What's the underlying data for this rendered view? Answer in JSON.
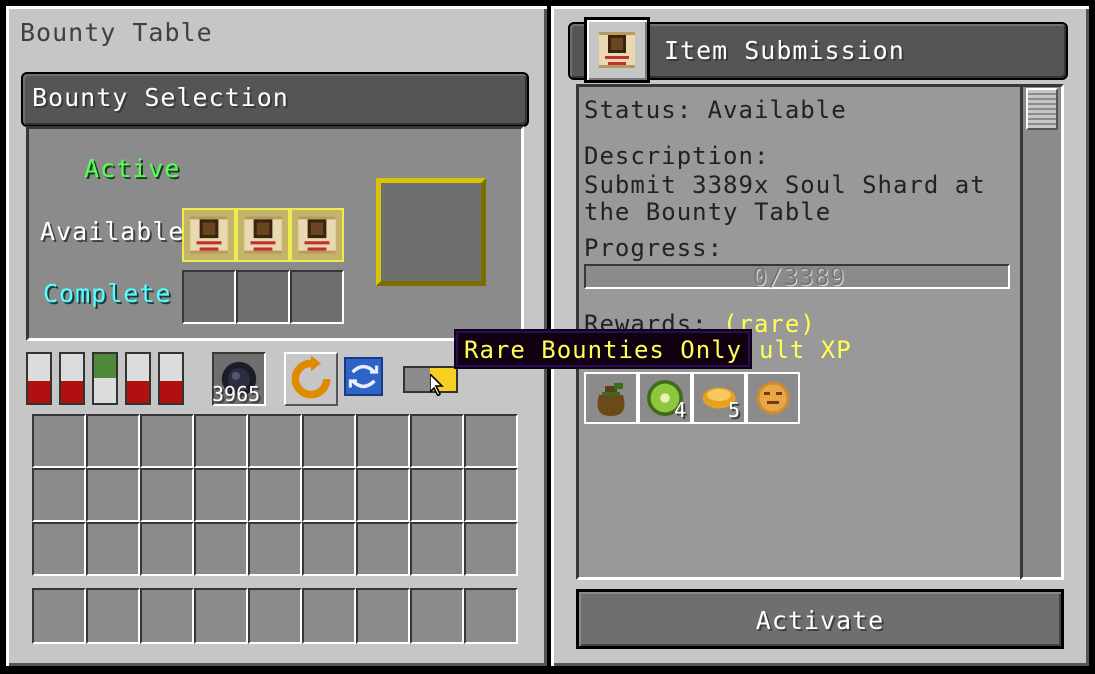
{
  "left_panel": {
    "title": "Bounty Table",
    "selection_header": "Bounty Selection",
    "labels": {
      "active": "Active",
      "available": "Available",
      "complete": "Complete"
    },
    "available_slots": [
      {
        "icon": "bounty-scroll"
      },
      {
        "icon": "bounty-scroll"
      },
      {
        "icon": "bounty-scroll"
      }
    ],
    "complete_slots": [
      {
        "icon": ""
      },
      {
        "icon": ""
      },
      {
        "icon": ""
      }
    ],
    "meters": [
      {
        "color": "#b01010",
        "level": "low"
      },
      {
        "color": "#b01010",
        "level": "low"
      },
      {
        "color": "#4e8a3a",
        "level": "high"
      },
      {
        "color": "#b01010",
        "level": "low"
      },
      {
        "color": "#b01010",
        "level": "low"
      }
    ],
    "currency": {
      "icon": "ender-pearl-icon",
      "count": "3965"
    },
    "reroll_icon": "reroll-arrow-icon",
    "refresh_icon": "refresh-icon",
    "toggle": {
      "state": "on",
      "color": "#f5d020"
    },
    "tooltip": "Rare Bounties Only"
  },
  "right_panel": {
    "header": "Item Submission",
    "header_icon": "bounty-scroll",
    "status": "Status: Available",
    "description_label": "Description:",
    "description_line1": "Submit 3389x Soul Shard at",
    "description_line2": "the Bounty Table",
    "progress_label": "Progress:",
    "progress_text": "0/3389",
    "progress_value": 0,
    "rewards_label": "Rewards:",
    "rewards_rarity": "(rare)",
    "rewards_xp_partial": "ult XP",
    "rewards": [
      {
        "icon": "sack-icon",
        "count": ""
      },
      {
        "icon": "kiwi-icon",
        "count": "4"
      },
      {
        "icon": "bread-icon",
        "count": "5"
      },
      {
        "icon": "cookie-icon",
        "count": ""
      }
    ],
    "activate_label": "Activate"
  }
}
